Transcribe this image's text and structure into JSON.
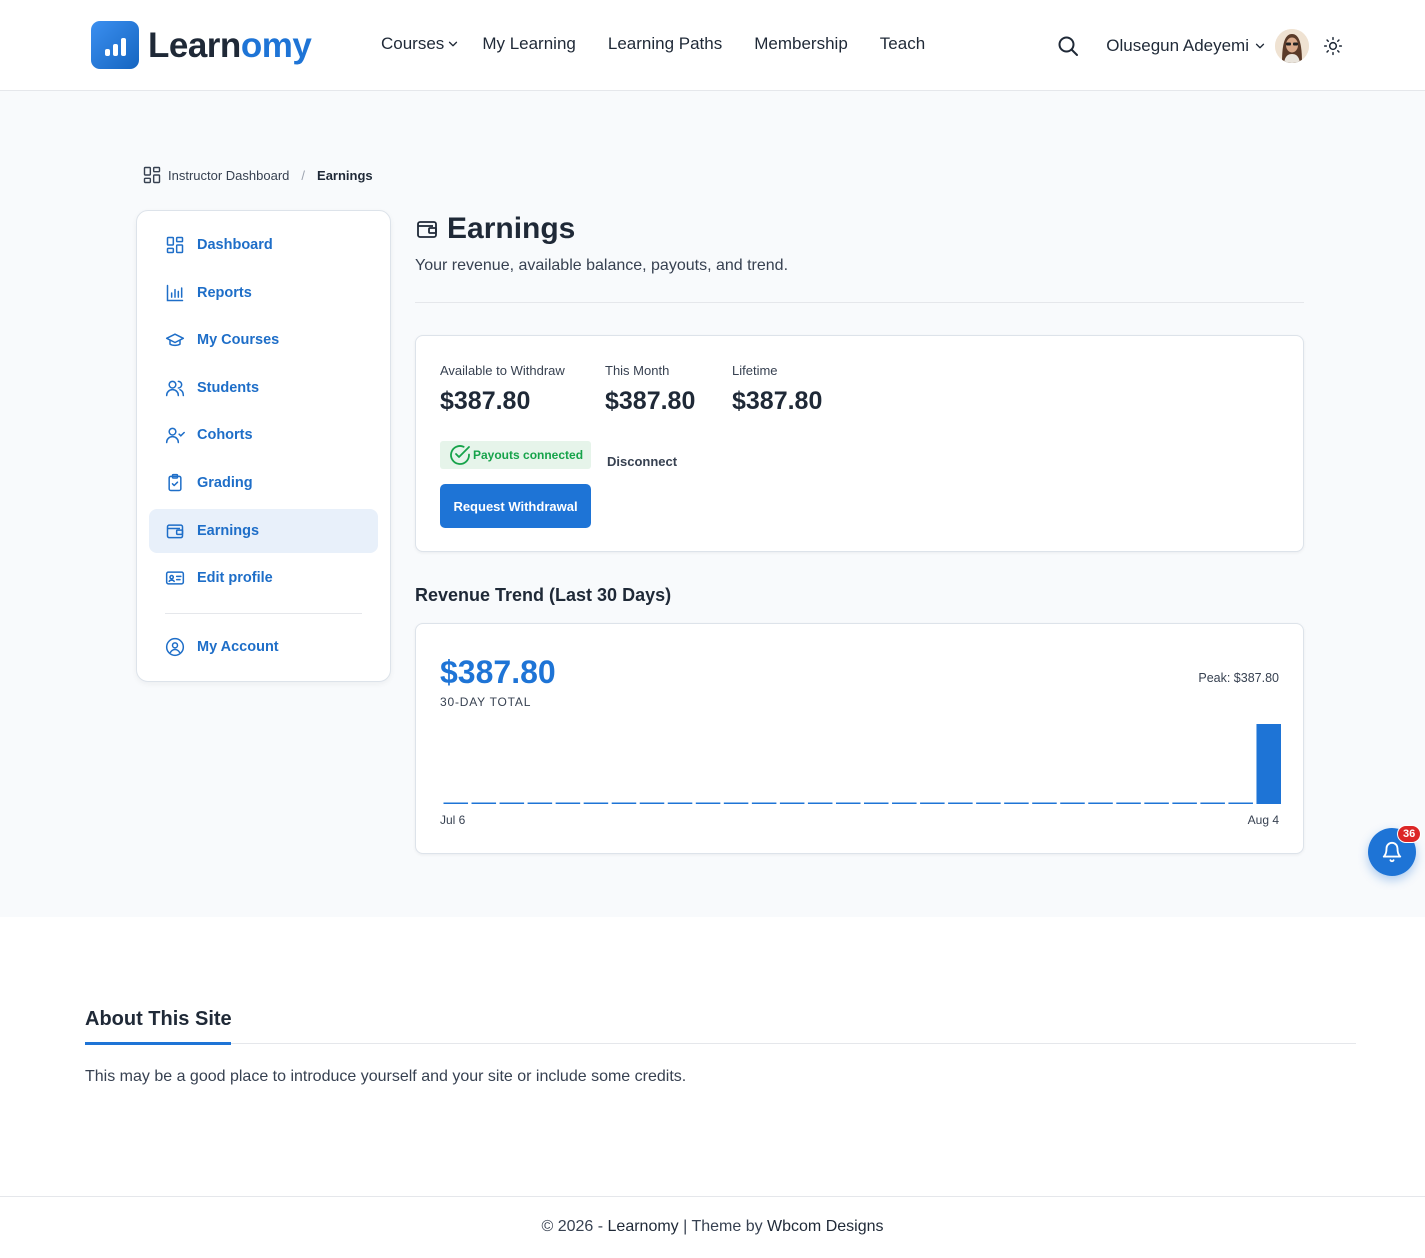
{
  "brand": {
    "name_part1": "Learn",
    "name_part2": "omy",
    "color": "#1e74d6"
  },
  "nav": {
    "items": [
      {
        "label": "Courses",
        "has_dropdown": true
      },
      {
        "label": "My Learning"
      },
      {
        "label": "Learning Paths"
      },
      {
        "label": "Membership"
      },
      {
        "label": "Teach"
      }
    ]
  },
  "header": {
    "user_name": "Olusegun Adeyemi",
    "search_icon": "search-icon",
    "theme_icon": "sun-icon"
  },
  "breadcrumb": {
    "parent": "Instructor Dashboard",
    "separator": "/",
    "current": "Earnings"
  },
  "sidebar": {
    "items": [
      {
        "label": "Dashboard",
        "icon": "dashboard-grid-icon"
      },
      {
        "label": "Reports",
        "icon": "bar-chart-icon"
      },
      {
        "label": "My Courses",
        "icon": "graduation-cap-icon"
      },
      {
        "label": "Students",
        "icon": "users-icon"
      },
      {
        "label": "Cohorts",
        "icon": "user-group-icon"
      },
      {
        "label": "Grading",
        "icon": "clipboard-check-icon"
      },
      {
        "label": "Earnings",
        "icon": "wallet-icon",
        "active": true
      },
      {
        "label": "Edit profile",
        "icon": "id-card-icon"
      }
    ],
    "account": {
      "label": "My Account",
      "icon": "user-circle-icon"
    }
  },
  "page": {
    "title": "Earnings",
    "subtitle": "Your revenue, available balance, payouts, and trend."
  },
  "stats": {
    "available": {
      "label": "Available to Withdraw",
      "value": "$387.80"
    },
    "month": {
      "label": "This Month",
      "value": "$387.80"
    },
    "lifetime": {
      "label": "Lifetime",
      "value": "$387.80"
    },
    "payouts_status": "Payouts connected",
    "disconnect_label": "Disconnect",
    "withdraw_label": "Request Withdrawal"
  },
  "trend": {
    "section_title": "Revenue Trend (Last 30 Days)",
    "total": "$387.80",
    "total_label": "30-DAY TOTAL",
    "peak": "Peak: $387.80",
    "start_label": "Jul 6",
    "end_label": "Aug 4"
  },
  "chart_data": {
    "type": "bar",
    "x_start": "Jul 6",
    "x_end": "Aug 4",
    "values": [
      0,
      0,
      0,
      0,
      0,
      0,
      0,
      0,
      0,
      0,
      0,
      0,
      0,
      0,
      0,
      0,
      0,
      0,
      0,
      0,
      0,
      0,
      0,
      0,
      0,
      0,
      0,
      0,
      0,
      387.8
    ],
    "ylim": [
      0,
      387.8
    ],
    "grid": false,
    "bar_color": "#1e74d6"
  },
  "notifications": {
    "count": "36",
    "icon": "bell-icon"
  },
  "about": {
    "title": "About This Site",
    "text": "This may be a good place to introduce yourself and your site or include some credits."
  },
  "footer": {
    "prefix": "© 2026 - ",
    "site": "Learnomy",
    "divider": " | Theme by ",
    "theme_author": "Wbcom Designs"
  }
}
